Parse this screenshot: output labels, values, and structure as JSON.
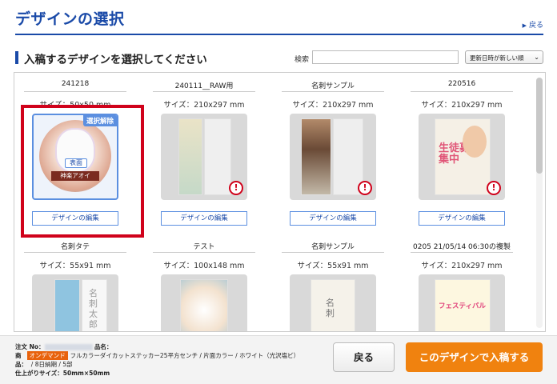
{
  "header": {
    "title": "デザインの選択",
    "back_link": "戻る"
  },
  "section": {
    "title": "入稿するデザインを選択してください",
    "search_label": "検索",
    "search_value": "",
    "sort_selected": "更新日時が新しい順"
  },
  "cards": [
    {
      "name": "241218",
      "size": "サイズ：50x50 mm",
      "edit": "デザインの編集",
      "selected": true,
      "deselect": "選択解除",
      "face_label": "表面",
      "plate_text": "神楽アオイ"
    },
    {
      "name": "240111__RAW用",
      "size": "サイズ：210x297 mm",
      "edit": "デザインの編集",
      "warning": "!"
    },
    {
      "name": "名刺サンプル",
      "size": "サイズ：210x297 mm",
      "edit": "デザインの編集",
      "warning": "!"
    },
    {
      "name": "220516",
      "size": "サイズ：210x297 mm",
      "edit": "デザインの編集",
      "warning": "!",
      "flyer_text": "生徒募集中"
    },
    {
      "name": "名刺タテ",
      "size": "サイズ：55x91 mm",
      "doc_text": "名刺 太郎"
    },
    {
      "name": "テスト",
      "size": "サイズ：100x148 mm"
    },
    {
      "name": "名刺サンプル",
      "size": "サイズ：55x91 mm",
      "doc_text": "名刺"
    },
    {
      "name": "0205 21/05/14 06:30の複製",
      "size": "サイズ：210x297 mm",
      "flyer_text": "フェスティバル"
    }
  ],
  "footer": {
    "order_no_label": "注文 No：",
    "product_label": "品名：",
    "product_label2": "商",
    "product_label3": "品：",
    "ondemand_badge": "オンデマンド",
    "product_desc": "フルカラーダイカットステッカー25平方センチ / 片面カラー / ホワイト（光沢塩ビ）",
    "delivery": "/ 8日納期 / 5部",
    "finish_size": "仕上がりサイズ：50mm×50mm",
    "back_button": "戻る",
    "submit_button": "このデザインで入稿する"
  },
  "colors": {
    "brand_blue": "#1a4aa8",
    "accent_orange": "#f0820f",
    "selection_red": "#d0021b"
  }
}
